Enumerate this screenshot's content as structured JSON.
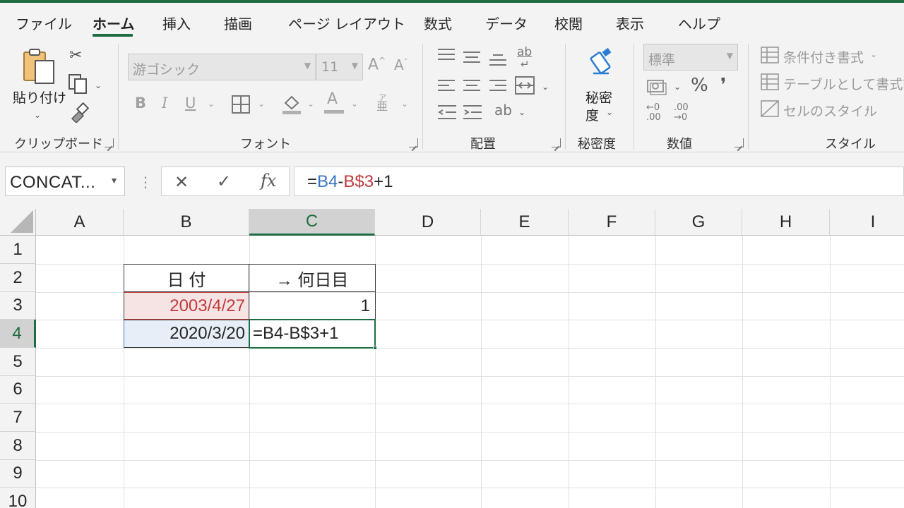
{
  "ribbon_tabs": [
    "ファイル",
    "ホーム",
    "挿入",
    "描画",
    "ページ レイアウト",
    "数式",
    "データ",
    "校閲",
    "表示",
    "ヘルプ"
  ],
  "active_tab": "ホーム",
  "clipboard": {
    "paste_label": "貼り付け",
    "group_label": "クリップボード"
  },
  "font": {
    "name": "游ゴシック",
    "size": "11",
    "bold": "B",
    "italic": "I",
    "underline": "U",
    "phonetic": "亜",
    "phonetic_ruby": "ア",
    "group_label": "フォント"
  },
  "alignment": {
    "group_label": "配置",
    "wrap_glyph": "ab"
  },
  "sensitivity": {
    "line1": "秘密",
    "line2": "度",
    "group_label": "秘密度"
  },
  "number": {
    "format": "標準",
    "percent": "%",
    "comma": "❜",
    "inc_decimal": "←0 .00",
    "dec_decimal": ".00 →0",
    "group_label": "数値"
  },
  "styles": {
    "conditional": "条件付き書式",
    "as_table": "テーブルとして書式設定",
    "cell_styles": "セルのスタイル",
    "group_label": "スタイル"
  },
  "formula_bar": {
    "name_box": "CONCAT...",
    "cancel": "✕",
    "enter": "✓",
    "fx": "fx",
    "formula_eq": "=",
    "formula_ref1": "B4",
    "formula_op": "-",
    "formula_ref2": "B$3",
    "formula_tail": "+1"
  },
  "columns": [
    "A",
    "B",
    "C",
    "D",
    "E",
    "F",
    "G",
    "H",
    "I"
  ],
  "selected_column": "C",
  "rows": [
    "1",
    "2",
    "3",
    "4",
    "5",
    "6",
    "7",
    "8",
    "9",
    "10"
  ],
  "selected_row": "4",
  "cells": {
    "B2": "日 付",
    "C2": "→ 何日目",
    "B3": "2003/4/27",
    "C3": "1",
    "B4": "2020/3/20",
    "C4": "=B4-B$3+1"
  },
  "colors": {
    "accent": "#1e6c41",
    "ref_blue": "#3a74c4",
    "ref_red": "#c0393b",
    "ref_blue_fill": "#e8eef8",
    "ref_red_fill": "#f6e4e4"
  }
}
